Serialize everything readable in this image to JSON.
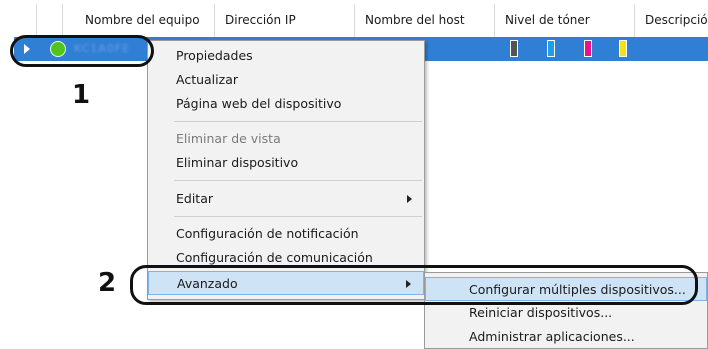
{
  "grid": {
    "columns": [
      "Nombre del equipo",
      "Dirección IP",
      "Nombre del host",
      "Nivel de tóner",
      "Descripció"
    ],
    "selected_row": {
      "status_color": "#52c41a",
      "device_name": "KC1A0FE",
      "toner_colors": [
        "#555555",
        "#1f9ee8",
        "#e6138a",
        "#f5e117"
      ]
    }
  },
  "callouts": {
    "one": "1",
    "two": "2"
  },
  "context_menu": {
    "items": [
      {
        "label": "Propiedades",
        "enabled": true
      },
      {
        "label": "Actualizar",
        "enabled": true
      },
      {
        "label": "Página web del dispositivo",
        "enabled": true
      },
      {
        "label": "Eliminar de vista",
        "enabled": false
      },
      {
        "label": "Eliminar dispositivo",
        "enabled": true
      },
      {
        "label": "Editar",
        "enabled": true,
        "submenu": true
      },
      {
        "label": "Configuración de notificación",
        "enabled": true
      },
      {
        "label": "Configuración de comunicación",
        "enabled": true
      },
      {
        "label": "Avanzado",
        "enabled": true,
        "submenu": true,
        "highlighted": true
      }
    ]
  },
  "submenu": {
    "items": [
      {
        "label": "Configurar múltiples dispositivos...",
        "highlighted": true
      },
      {
        "label": "Reiniciar dispositivos..."
      },
      {
        "label": "Administrar aplicaciones..."
      }
    ]
  },
  "colors": {
    "selection": "#2f7fd4",
    "menu_highlight": "#cfe3f7",
    "menu_bg": "#f2f2f2"
  }
}
